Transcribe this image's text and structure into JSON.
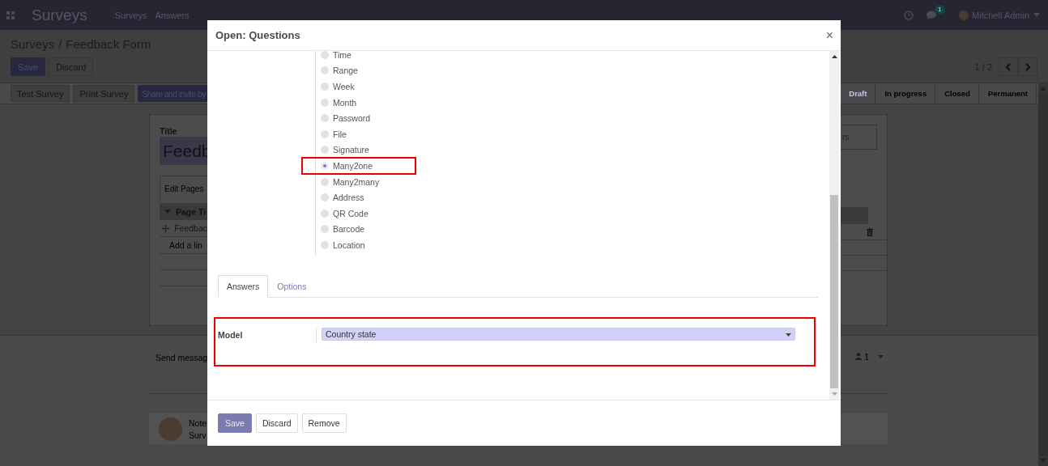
{
  "navbar": {
    "app_name": "Surveys",
    "menu": [
      "Surveys",
      "Answers"
    ],
    "message_count": "1",
    "user": "Mitchell Admin"
  },
  "breadcrumb": {
    "parent": "Surveys",
    "separator": "/",
    "current": "Feedback Form"
  },
  "form_buttons": [
    {
      "label": "Save",
      "kind": "primary"
    },
    {
      "label": "Discard",
      "kind": "secondary"
    }
  ],
  "pager": "1 / 2",
  "header_buttons": [
    {
      "label": "Test Survey",
      "kind": "secondary"
    },
    {
      "label": "Print Survey",
      "kind": "secondary"
    },
    {
      "label": "Share and invite by",
      "kind": "primary"
    }
  ],
  "stages": [
    {
      "label": "Draft",
      "selected": true
    },
    {
      "label": "In progress",
      "selected": false
    },
    {
      "label": "Closed",
      "selected": false
    },
    {
      "label": "Permanent",
      "selected": false
    }
  ],
  "sheet": {
    "title_label": "Title",
    "title_value": "Feedb",
    "tab": "Edit Pages",
    "column": "Page Ti",
    "row": "Feedbac",
    "add_line": "Add a lin",
    "side_button": "rs"
  },
  "chatter": {
    "send_message": "Send messag",
    "followers": "1",
    "note_label": "Note",
    "note_text": "Surv"
  },
  "dialog": {
    "title": "Open: Questions",
    "close": "×",
    "question_types": [
      {
        "label": "Time",
        "selected": false,
        "highlighted": false
      },
      {
        "label": "Range",
        "selected": false,
        "highlighted": false
      },
      {
        "label": "Week",
        "selected": false,
        "highlighted": false
      },
      {
        "label": "Month",
        "selected": false,
        "highlighted": false
      },
      {
        "label": "Password",
        "selected": false,
        "highlighted": false
      },
      {
        "label": "File",
        "selected": false,
        "highlighted": false
      },
      {
        "label": "Signature",
        "selected": false,
        "highlighted": false
      },
      {
        "label": "Many2one",
        "selected": true,
        "highlighted": true
      },
      {
        "label": "Many2many",
        "selected": false,
        "highlighted": false
      },
      {
        "label": "Address",
        "selected": false,
        "highlighted": false
      },
      {
        "label": "QR Code",
        "selected": false,
        "highlighted": false
      },
      {
        "label": "Barcode",
        "selected": false,
        "highlighted": false
      },
      {
        "label": "Location",
        "selected": false,
        "highlighted": false
      }
    ],
    "tabs": [
      {
        "label": "Answers",
        "selected": true
      },
      {
        "label": "Options",
        "selected": false
      }
    ],
    "model_label": "Model",
    "model_value": "Country state",
    "model_highlighted": true,
    "buttons": [
      {
        "label": "Save",
        "kind": "primary"
      },
      {
        "label": "Discard",
        "kind": "secondary"
      },
      {
        "label": "Remove",
        "kind": "secondary"
      }
    ]
  }
}
